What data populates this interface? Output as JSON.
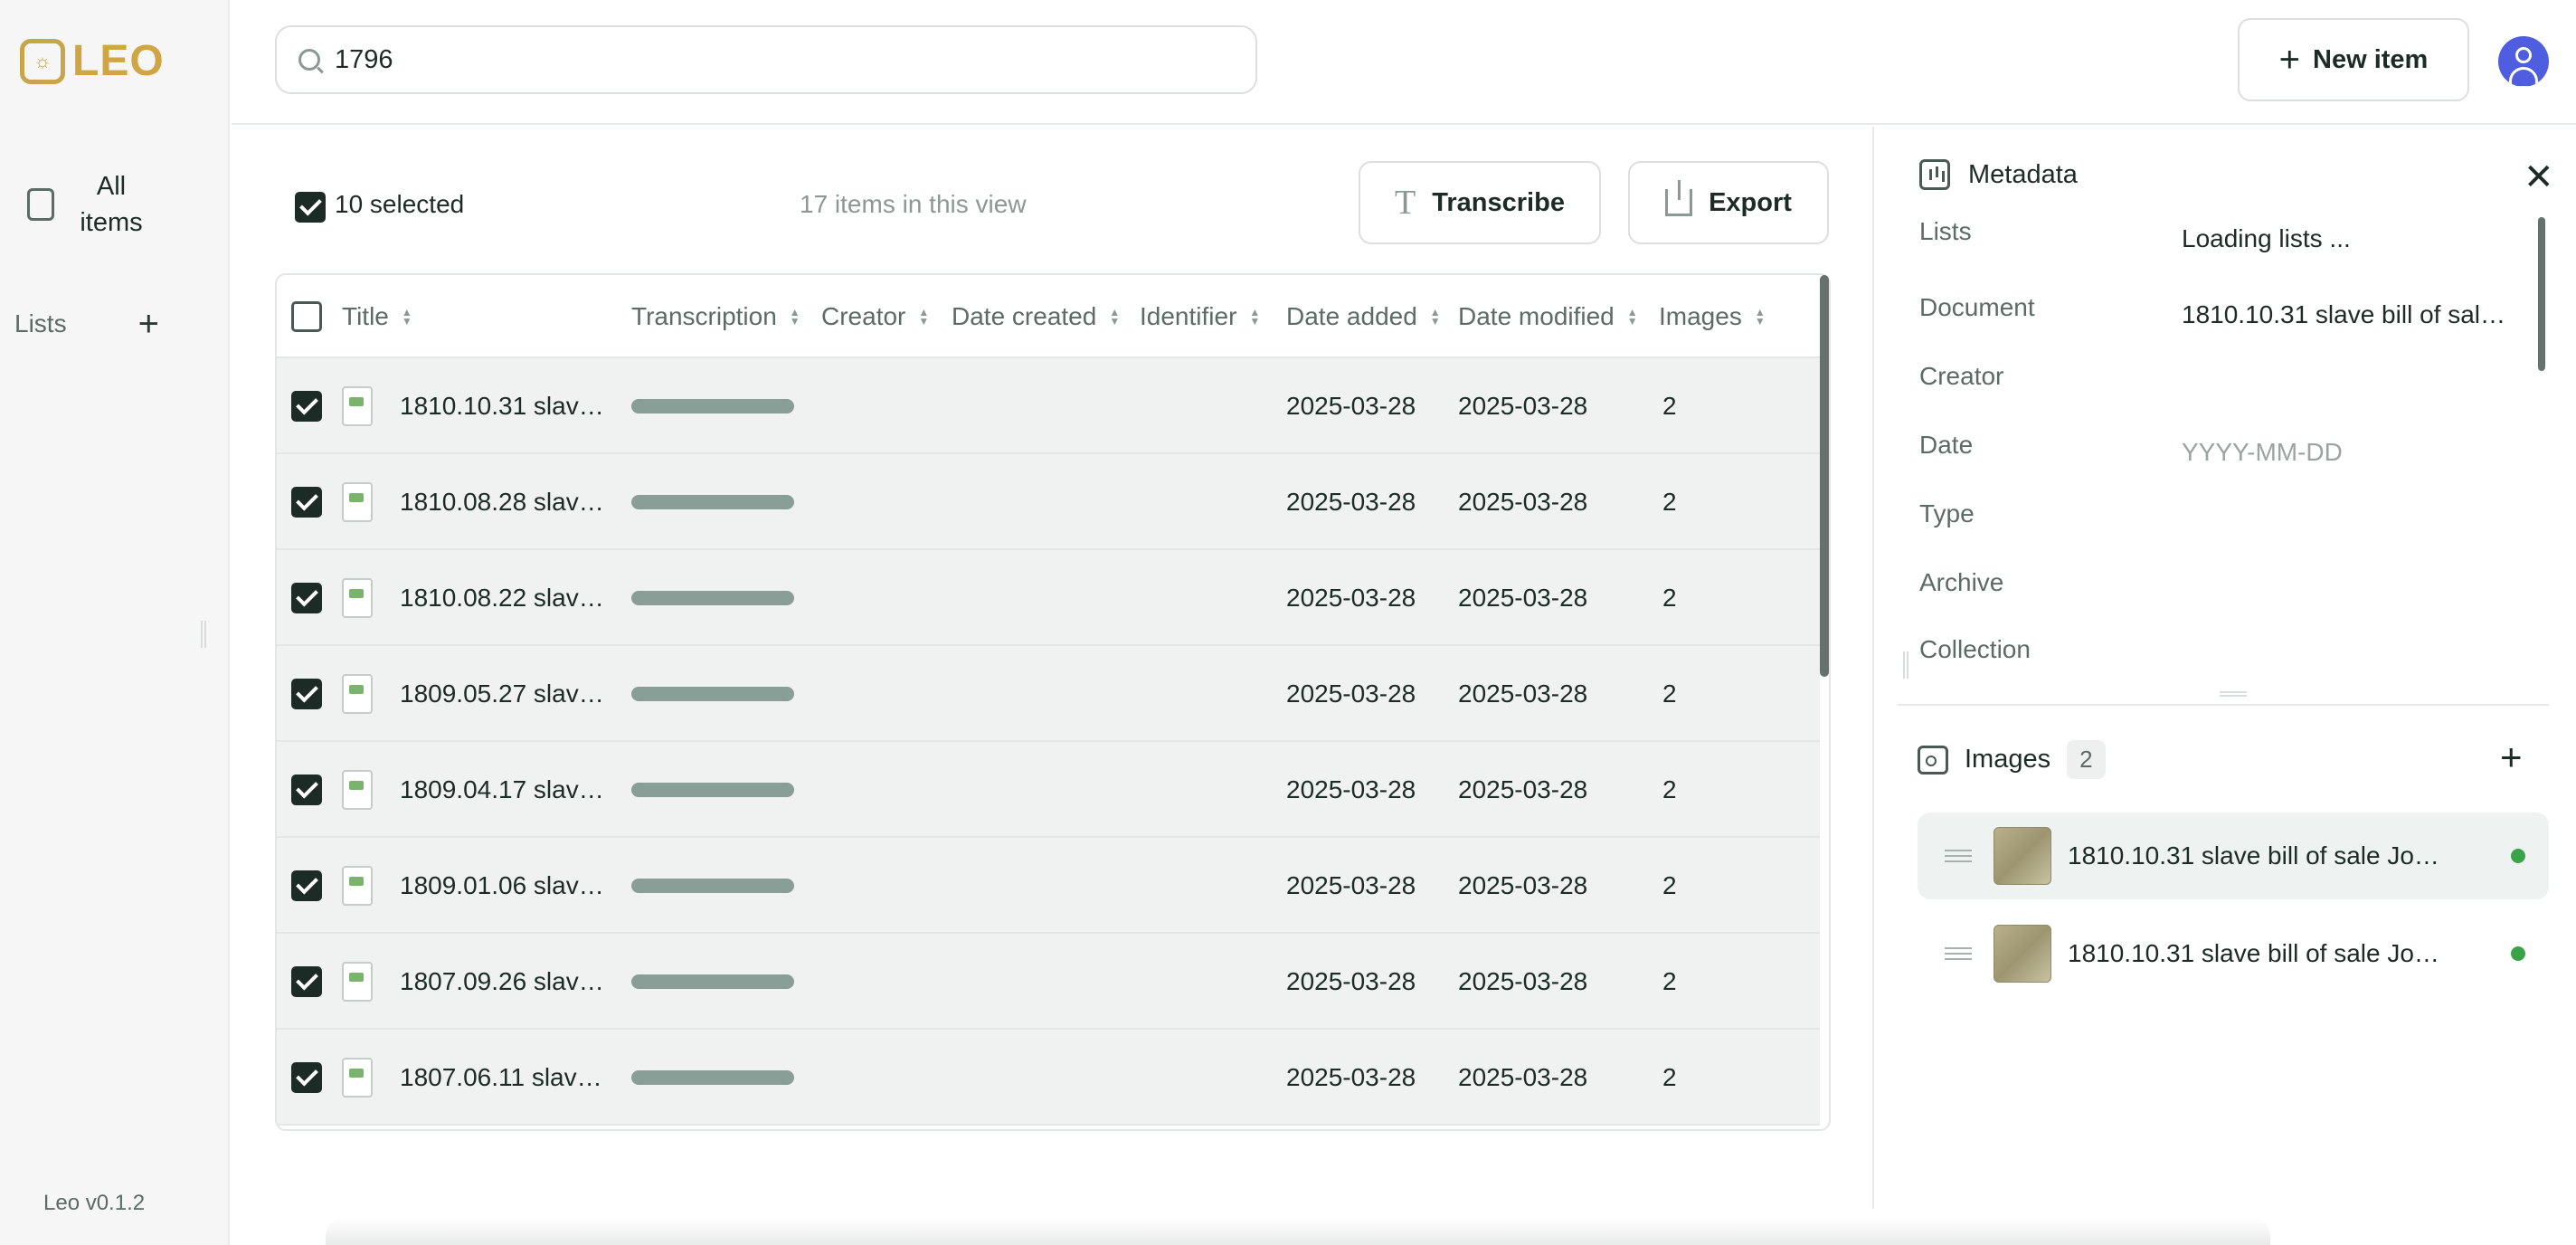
{
  "app": {
    "logo_text": "LEO",
    "version": "Leo v0.1.2"
  },
  "sidebar": {
    "all_items_label": "All items",
    "lists_label": "Lists"
  },
  "search": {
    "value": "1796",
    "placeholder": ""
  },
  "header": {
    "new_item_label": "New item"
  },
  "toolbar": {
    "selected_text": "10 selected",
    "count_text": "17 items in this view",
    "transcribe_label": "Transcribe",
    "export_label": "Export"
  },
  "table": {
    "columns": [
      "Title",
      "Transcription",
      "Creator",
      "Date created",
      "Identifier",
      "Date added",
      "Date modified",
      "Images"
    ],
    "rows": [
      {
        "title": "1810.10.31 slav…",
        "date_added": "2025-03-28",
        "date_modified": "2025-03-28",
        "images": "2"
      },
      {
        "title": "1810.08.28 slav…",
        "date_added": "2025-03-28",
        "date_modified": "2025-03-28",
        "images": "2"
      },
      {
        "title": "1810.08.22 slav…",
        "date_added": "2025-03-28",
        "date_modified": "2025-03-28",
        "images": "2"
      },
      {
        "title": "1809.05.27 slav…",
        "date_added": "2025-03-28",
        "date_modified": "2025-03-28",
        "images": "2"
      },
      {
        "title": "1809.04.17 slav…",
        "date_added": "2025-03-28",
        "date_modified": "2025-03-28",
        "images": "2"
      },
      {
        "title": "1809.01.06 slav…",
        "date_added": "2025-03-28",
        "date_modified": "2025-03-28",
        "images": "2"
      },
      {
        "title": "1807.09.26 slav…",
        "date_added": "2025-03-28",
        "date_modified": "2025-03-28",
        "images": "2"
      },
      {
        "title": "1807.06.11 slav…",
        "date_added": "2025-03-28",
        "date_modified": "2025-03-28",
        "images": "2"
      }
    ]
  },
  "metadata": {
    "title": "Metadata",
    "fields": [
      {
        "label": "Lists",
        "value": "Loading lists ..."
      },
      {
        "label": "Document",
        "value": "1810.10.31 slave bill of sale…"
      },
      {
        "label": "Creator",
        "value": ""
      },
      {
        "label": "Date",
        "value": "",
        "placeholder": "YYYY-MM-DD"
      },
      {
        "label": "Type",
        "value": ""
      },
      {
        "label": "Archive",
        "value": ""
      },
      {
        "label": "Collection",
        "value": ""
      }
    ]
  },
  "images_panel": {
    "title": "Images",
    "count": "2",
    "items": [
      {
        "name": "1810.10.31 slave bill of sale Joh…"
      },
      {
        "name": "1810.10.31 slave bill of sale Joh…"
      }
    ]
  },
  "colors": {
    "accent": "#1d2b26",
    "logo": "#d0a544",
    "avatar": "#4f5de0",
    "status_dot": "#3aa34a"
  }
}
